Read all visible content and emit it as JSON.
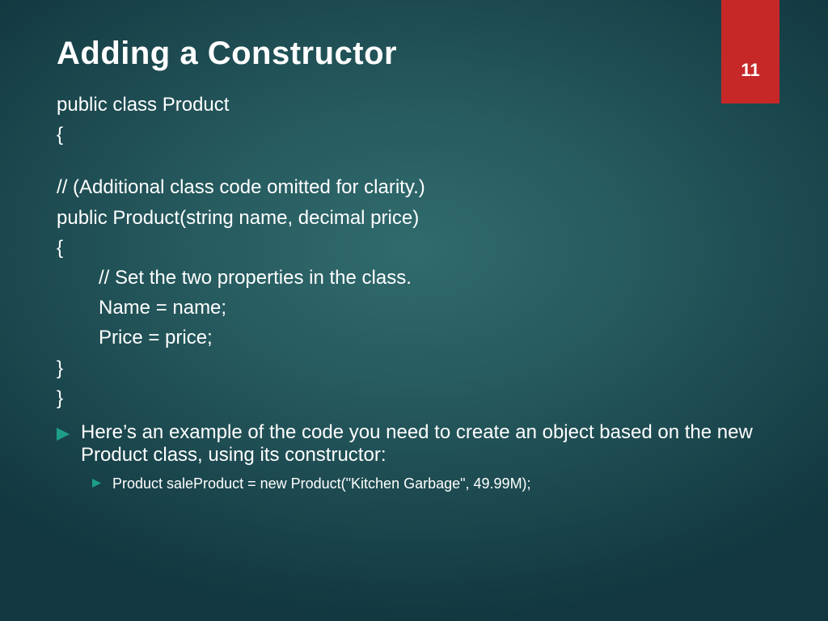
{
  "slide_number": "11",
  "title": "Adding a Constructor",
  "code": {
    "l1": "public class Product",
    "l2": "{",
    "l3": "// (Additional class code omitted for clarity.)",
    "l4": "public Product(string name, decimal price)",
    "l5": "{",
    "l6": "// Set the two properties in the class.",
    "l7": "Name = name;",
    "l8": "Price = price;",
    "l9": "}",
    "l10": "}"
  },
  "bullets": {
    "b1": "Here’s an example of the code you need to create an object based on the new Product class, using its constructor:",
    "b2": "Product saleProduct = new Product(\"Kitchen Garbage\", 49.99M);"
  },
  "colors": {
    "accent": "#1e9e8a",
    "ribbon": "#c62828"
  }
}
